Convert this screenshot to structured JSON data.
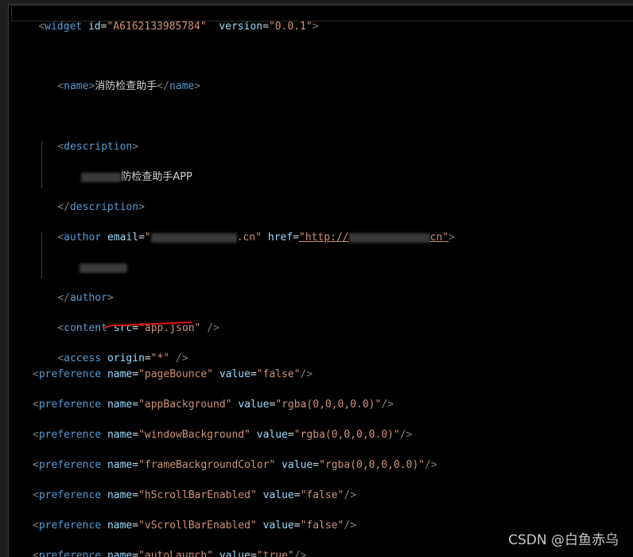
{
  "editor": {
    "widget_line": {
      "tag": "widget",
      "id_attr": "id",
      "id_value": "\"A6162133985784\"",
      "version_attr": "version",
      "version_value": "\"0.0.1\""
    },
    "name_line": {
      "open": "name",
      "text": "消防检查助手",
      "close": "name"
    },
    "description_open": "description",
    "description_text": "防检查助手APP",
    "description_close": "description",
    "author_line": {
      "tag": "author",
      "email_attr": "email",
      "email_visible_end": ".cn\"",
      "href_attr": "href",
      "href_visible_start": "\"http://",
      "href_visible_end": "cn\""
    },
    "author_close": "author",
    "content_line": {
      "tag": "content",
      "src_attr": "src",
      "src_value": "\"app.json\""
    },
    "access_line": {
      "tag": "access",
      "origin_attr": "origin",
      "origin_value": "\"*\""
    },
    "preferences": [
      {
        "name": "\"pageBounce\"",
        "value": "\"false\""
      },
      {
        "name": "\"appBackground\"",
        "value": "\"rgba(0,0,0,0.0)\""
      },
      {
        "name": "\"windowBackground\"",
        "value": "\"rgba(0,0,0,0.0)\""
      },
      {
        "name": "\"frameBackgroundColor\"",
        "value": "\"rgba(0,0,0,0.0)\""
      },
      {
        "name": "\"hScrollBarEnabled\"",
        "value": "\"false\""
      },
      {
        "name": "\"vScrollBarEnabled\"",
        "value": "\"false\""
      },
      {
        "name": "\"autoLaunch\"",
        "value": "\"true\""
      }
    ],
    "pref_tag": "preference",
    "pref_name_attr": "name",
    "pref_value_attr": "value"
  },
  "watermark": "CSDN @白鱼赤乌",
  "colors": {
    "background": "#000000",
    "tag": "#569cd6",
    "attribute": "#9cdcfe",
    "string": "#ce9178",
    "punctuation": "#808080",
    "annotation": "#e01010"
  }
}
